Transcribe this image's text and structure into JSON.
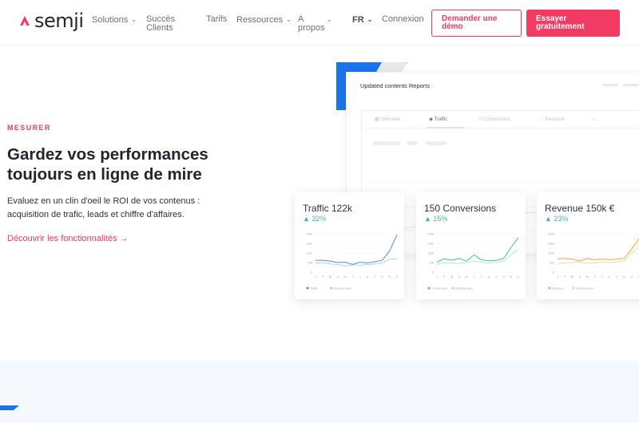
{
  "brand": {
    "name": "semji",
    "color": "#f03a5f"
  },
  "nav": {
    "items": [
      {
        "label": "Solutions",
        "dropdown": true
      },
      {
        "label": "Succès Clients",
        "dropdown": false
      },
      {
        "label": "Tarifs",
        "dropdown": false
      },
      {
        "label": "Ressources",
        "dropdown": true
      },
      {
        "label": "A propos",
        "dropdown": true
      },
      {
        "label": "FR",
        "dropdown": true
      },
      {
        "label": "Connexion",
        "dropdown": false
      }
    ],
    "demo_button": "Demander une démo",
    "trial_button": "Essayer gratuitement"
  },
  "hero": {
    "eyebrow": "MESURER",
    "headline": "Gardez vos performances toujours en ligne de mire",
    "lead": "Evaluez en un clin d'oeil le ROI de vos contenus : acquisition de trafic, leads et chiffre d'affaires.",
    "cta": "Découvrir les fonctionnalités →"
  },
  "dashboard": {
    "title": "Updated contents Reports",
    "tabs": [
      "Overview",
      "Traffic",
      "Conversions",
      "Revenue"
    ],
    "active_tab": "Traffic"
  },
  "cards": [
    {
      "title": "Traffic 122k",
      "delta": "▲ 32%",
      "color": "#4a90e2",
      "prev_color": "#9cc4f3",
      "chart_data": {
        "type": "line",
        "x": [
          "J",
          "F",
          "M",
          "A",
          "M",
          "J",
          "J",
          "A",
          "S",
          "O",
          "N",
          "D"
        ],
        "yticks": [
          "200k",
          "150k",
          "100k",
          "50k",
          "0"
        ],
        "ylim": [
          0,
          200
        ],
        "series": [
          {
            "name": "Traffic",
            "values": [
              62,
              62,
              58,
              50,
              52,
              40,
              52,
              48,
              54,
              62,
              110,
              195
            ]
          },
          {
            "name": "Previous year",
            "values": [
              48,
              50,
              42,
              40,
              32,
              38,
              36,
              40,
              42,
              48,
              68,
              70
            ]
          }
        ]
      }
    },
    {
      "title": "150 Conversions",
      "delta": "▲ 15%",
      "color": "#3fc49a",
      "prev_color": "#9fe3c9",
      "chart_data": {
        "type": "line",
        "x": [
          "J",
          "F",
          "M",
          "A",
          "M",
          "J",
          "J",
          "A",
          "S",
          "O",
          "N",
          "D"
        ],
        "yticks": [
          "200k",
          "150k",
          "100k",
          "50k",
          "0"
        ],
        "ylim": [
          0,
          200
        ],
        "series": [
          {
            "name": "Conversions",
            "values": [
              52,
              70,
              62,
              72,
              58,
              90,
              64,
              60,
              62,
              72,
              128,
              180
            ]
          },
          {
            "name": "Previous year",
            "values": [
              40,
              50,
              48,
              44,
              50,
              58,
              52,
              48,
              52,
              60,
              90,
              120
            ]
          }
        ]
      }
    },
    {
      "title": "Revenue 150k €",
      "delta": "▲ 23%",
      "color": "#f5a33b",
      "prev_color": "#f8cf8f",
      "chart_data": {
        "type": "line",
        "x": [
          "J",
          "F",
          "M",
          "A",
          "M",
          "J",
          "J",
          "A",
          "S",
          "O",
          "N",
          "D"
        ],
        "yticks": [
          "200k",
          "150k",
          "100k",
          "50k",
          "0"
        ],
        "ylim": [
          0,
          200
        ],
        "series": [
          {
            "name": "Revenue",
            "values": [
              70,
              72,
              68,
              58,
              72,
              66,
              68,
              66,
              68,
              72,
              120,
              175
            ]
          },
          {
            "name": "Previous year",
            "values": [
              44,
              48,
              50,
              52,
              46,
              48,
              52,
              50,
              54,
              60,
              100,
              130
            ]
          }
        ]
      }
    }
  ]
}
